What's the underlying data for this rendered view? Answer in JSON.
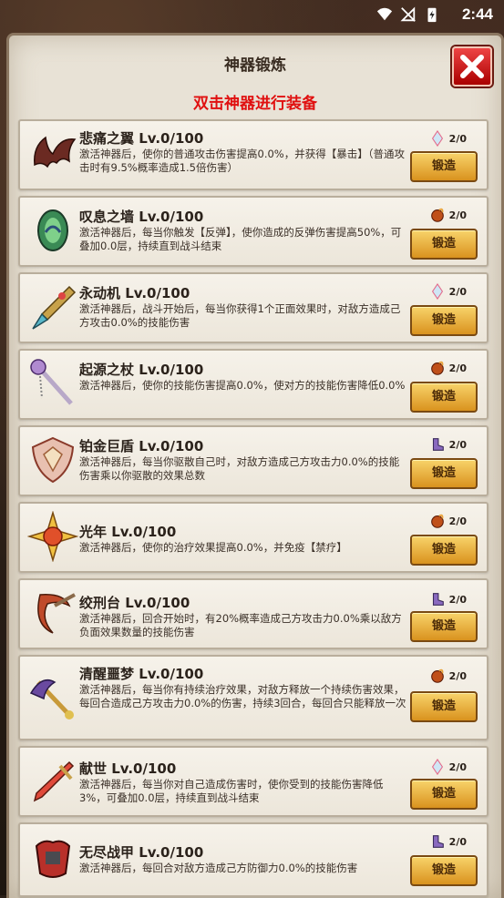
{
  "status": {
    "time": "2:44"
  },
  "panel": {
    "title": "神器锻炼",
    "subtitle": "双击神器进行装备"
  },
  "forge_label": "锻造",
  "artifacts": [
    {
      "name": "悲痛之翼 Lv.0/100",
      "desc": "激活神器后，使你的普通攻击伤害提高0.0%，并获得【暴击】（普通攻击时有9.5%概率造成1.5倍伤害）",
      "cost": "2/0",
      "cost_icon": "crystal-icon",
      "icon": "wing-icon"
    },
    {
      "name": "叹息之墙 Lv.0/100",
      "desc": "激活神器后，每当你触发【反弹】，使你造成的反弹伤害提高50%，可叠加0.0层，持续直到战斗结束",
      "cost": "2/0",
      "cost_icon": "ember-icon",
      "icon": "green-shield-icon"
    },
    {
      "name": "永动机 Lv.0/100",
      "desc": "激活神器后，战斗开始后，每当你获得1个正面效果时，对敌方造成己方攻击0.0%的技能伤害",
      "cost": "2/0",
      "cost_icon": "crystal-icon",
      "icon": "drill-icon"
    },
    {
      "name": "起源之杖 Lv.0/100",
      "desc": "激活神器后，使你的技能伤害提高0.0%，使对方的技能伤害降低0.0%",
      "cost": "2/0",
      "cost_icon": "ember-icon",
      "icon": "staff-icon"
    },
    {
      "name": "铂金巨盾 Lv.0/100",
      "desc": "激活神器后，每当你驱散自己时，对敌方造成己方攻击力0.0%的技能伤害乘以你驱散的效果总数",
      "cost": "2/0",
      "cost_icon": "boot-icon",
      "icon": "platinum-shield-icon"
    },
    {
      "name": "光年 Lv.0/100",
      "desc": "激活神器后，使你的治疗效果提高0.0%，并免疫【禁疗】",
      "cost": "2/0",
      "cost_icon": "ember-icon",
      "icon": "star-orb-icon"
    },
    {
      "name": "绞刑台 Lv.0/100",
      "desc": "激活神器后，回合开始时，有20%概率造成己方攻击力0.0%乘以敌方负面效果数量的技能伤害",
      "cost": "2/0",
      "cost_icon": "boot-icon",
      "icon": "scythe-icon"
    },
    {
      "name": "清醒噩梦 Lv.0/100",
      "desc": "激活神器后，每当你有持续治疗效果，对敌方释放一个持续伤害效果，每回合造成己方攻击力0.0%的伤害，持续3回合，每回合只能释放一次",
      "cost": "2/0",
      "cost_icon": "ember-icon",
      "icon": "dragon-staff-icon"
    },
    {
      "name": "献世 Lv.0/100",
      "desc": "激活神器后，每当你对自己造成伤害时，使你受到的技能伤害降低3%，可叠加0.0层，持续直到战斗结束",
      "cost": "2/0",
      "cost_icon": "crystal-icon",
      "icon": "dagger-icon"
    },
    {
      "name": "无尽战甲 Lv.0/100",
      "desc": "激活神器后，每回合对敌方造成己方防御力0.0%的技能伤害",
      "cost": "2/0",
      "cost_icon": "boot-icon",
      "icon": "armor-icon"
    }
  ]
}
